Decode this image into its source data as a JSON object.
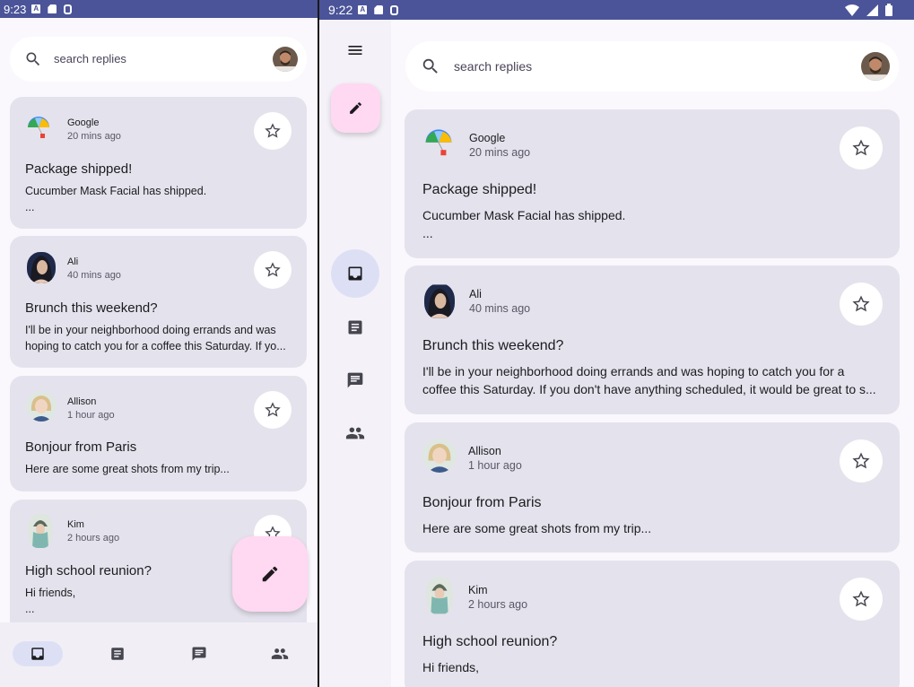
{
  "left": {
    "status": {
      "time": "9:23"
    },
    "search": {
      "placeholder": "search replies"
    },
    "emails": [
      {
        "sender": "Google",
        "time": "20 mins ago",
        "subject": "Package shipped!",
        "body": "Cucumber Mask Facial has shipped.\n..."
      },
      {
        "sender": "Ali",
        "time": "40 mins ago",
        "subject": "Brunch this weekend?",
        "body": "I'll be in your neighborhood doing errands and was hoping to catch you for a coffee this Saturday. If yo..."
      },
      {
        "sender": "Allison",
        "time": "1 hour ago",
        "subject": "Bonjour from Paris",
        "body": "Here are some great shots from my trip..."
      },
      {
        "sender": "Kim",
        "time": "2 hours ago",
        "subject": "High school reunion?",
        "body": "Hi friends,\n..."
      }
    ]
  },
  "right": {
    "status": {
      "time": "9:22"
    },
    "search": {
      "placeholder": "search replies"
    },
    "emails": [
      {
        "sender": "Google",
        "time": "20 mins ago",
        "subject": "Package shipped!",
        "body": "Cucumber Mask Facial has shipped.\n..."
      },
      {
        "sender": "Ali",
        "time": "40 mins ago",
        "subject": "Brunch this weekend?",
        "body": "I'll be in your neighborhood doing errands and was hoping to catch you for a coffee this Saturday. If you don't have anything scheduled, it would be great to s..."
      },
      {
        "sender": "Allison",
        "time": "1 hour ago",
        "subject": "Bonjour from Paris",
        "body": "Here are some great shots from my trip..."
      },
      {
        "sender": "Kim",
        "time": "2 hours ago",
        "subject": "High school reunion?",
        "body": "Hi friends,"
      }
    ]
  },
  "nav": {
    "items": [
      {
        "icon": "inbox-icon",
        "selected": true
      },
      {
        "icon": "article-icon",
        "selected": false
      },
      {
        "icon": "chat-icon",
        "selected": false
      },
      {
        "icon": "people-icon",
        "selected": false
      }
    ]
  },
  "colors": {
    "status_bar": "#4b5498",
    "card_bg": "#e4e2ec",
    "fab_bg": "#ffd8f1",
    "nav_selected": "#dde0f5",
    "background": "#fbf8fd"
  }
}
